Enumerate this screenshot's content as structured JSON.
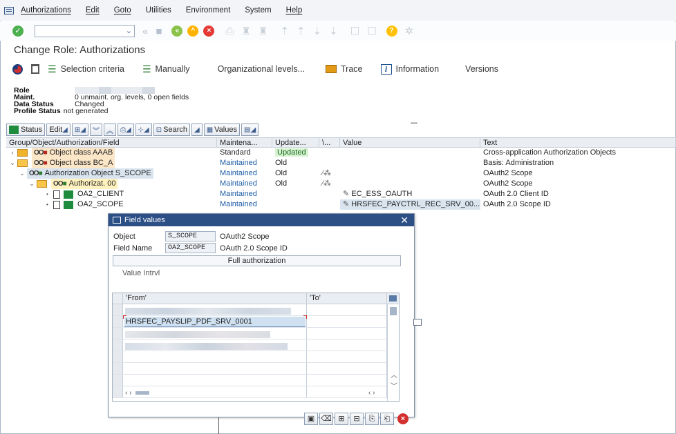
{
  "menu": {
    "items": [
      {
        "label": "Authorizations",
        "underline": true
      },
      {
        "label": "Edit",
        "underline": true
      },
      {
        "label": "Goto",
        "underline": true
      },
      {
        "label": "Utilities",
        "underline": false
      },
      {
        "label": "Environment",
        "underline": false
      },
      {
        "label": "System",
        "underline": false
      },
      {
        "label": "Help",
        "underline": true
      }
    ]
  },
  "toolbar": {
    "command_value": "",
    "icons": [
      "ok-icon",
      "save-icon",
      "back-icon",
      "exit-icon",
      "cancel-icon",
      "print-icon",
      "find-icon",
      "find-next-icon",
      "first-page-icon",
      "prev-page-icon",
      "next-page-icon",
      "last-page-icon",
      "new-session-icon",
      "shortcut-icon",
      "help-icon",
      "settings-icon"
    ]
  },
  "page_title": "Change Role: Authorizations",
  "app_toolbar": {
    "selection_criteria": "Selection criteria",
    "manually": "Manually",
    "org_levels": "Organizational levels...",
    "trace": "Trace",
    "information": "Information",
    "versions": "Versions"
  },
  "header": {
    "role_label": "Role",
    "maint_label": "Maint.",
    "maint_value": "0 unmaint. org. levels, 0 open fields",
    "data_status_label": "Data Status",
    "data_status_value": "Changed",
    "profile_status_label": "Profile Status",
    "profile_status_value": "not generated"
  },
  "grid_toolbar": {
    "status": "Status",
    "edit": "Edit",
    "search": "Search",
    "values": "Values"
  },
  "tree": {
    "columns": [
      "Group/Object/Authorization/Field",
      "Maintena...",
      "Update...",
      "\\...",
      "Value",
      "Text"
    ],
    "rows": [
      {
        "name": "Object class AAAB",
        "maint": "Standard",
        "update": "Updated",
        "value": "",
        "text": "Cross-application Authorization Objects"
      },
      {
        "name": "Object class BC_A",
        "maint": "Maintained",
        "update": "Old",
        "value": "",
        "text": "Basis: Administration"
      },
      {
        "name": "Authorization Object S_SCOPE",
        "maint": "Maintained",
        "update": "Old",
        "value": "",
        "text": "OAuth2 Scope"
      },
      {
        "name": "Authorizat. 00",
        "maint": "Maintained",
        "update": "Old",
        "value": "",
        "text": "OAuth2 Scope"
      },
      {
        "name": "OA2_CLIENT",
        "maint": "Maintained",
        "update": "",
        "value": "EC_ESS_OAUTH",
        "text": "OAuth 2.0 Client ID"
      },
      {
        "name": "OA2_SCOPE",
        "maint": "Maintained",
        "update": "",
        "value": "HRSFEC_PAYCTRL_REC_SRV_00...",
        "text": "OAuth 2.0 Scope ID"
      }
    ]
  },
  "dialog": {
    "title": "Field values",
    "object_label": "Object",
    "object_value": "S_SCOPE",
    "object_desc": "OAuth2 Scope",
    "field_label": "Field Name",
    "field_value": "OA2_SCOPE",
    "field_desc": "OAuth 2.0 Scope ID",
    "full_auth": "Full authorization",
    "value_interval": "Value Intrvl",
    "col_from": "'From'",
    "col_to": "'To'",
    "entry_value": "HRSFEC_PAYSLIP_PDF_SRV_0001"
  },
  "colors": {
    "accent": "#2c4f86",
    "maintained": "#1d5ea8",
    "updated_bg": "#d6f2d0",
    "green": "#1e8c3c"
  }
}
